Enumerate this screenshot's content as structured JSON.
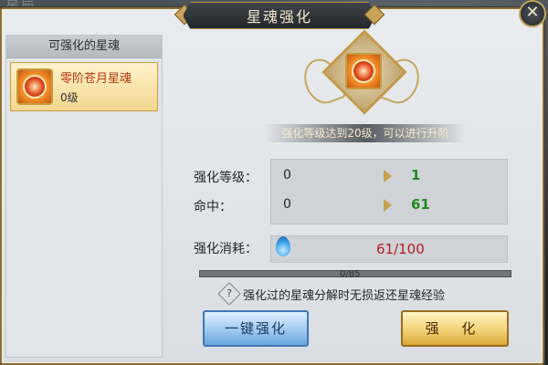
{
  "background": {
    "glyph": "星辰"
  },
  "window": {
    "title": "星魂强化",
    "close_icon": "close-icon"
  },
  "list": {
    "header": "可强化的星魂",
    "items": [
      {
        "name": "零阶苍月星魂",
        "level": "0级"
      }
    ]
  },
  "emblem": {
    "hint": "强化等级达到20级，可以进行升阶"
  },
  "stats": [
    {
      "label": "强化等级：",
      "current": "0",
      "next": "1"
    },
    {
      "label": "命中：",
      "current": "0",
      "next": "61"
    }
  ],
  "cost": {
    "label": "强化消耗：",
    "value": "61/100"
  },
  "exp": {
    "text": "0/85",
    "fraction": 0
  },
  "tip": {
    "icon": "?",
    "text": "强化过的星魂分解时无损返还星魂经验"
  },
  "buttons": {
    "one_key": "一键强化",
    "upgrade": "强 化"
  },
  "colors": {
    "accent_gold": "#c49a47",
    "next_green": "#1f8a1f",
    "cost_red": "#b51d1d"
  }
}
